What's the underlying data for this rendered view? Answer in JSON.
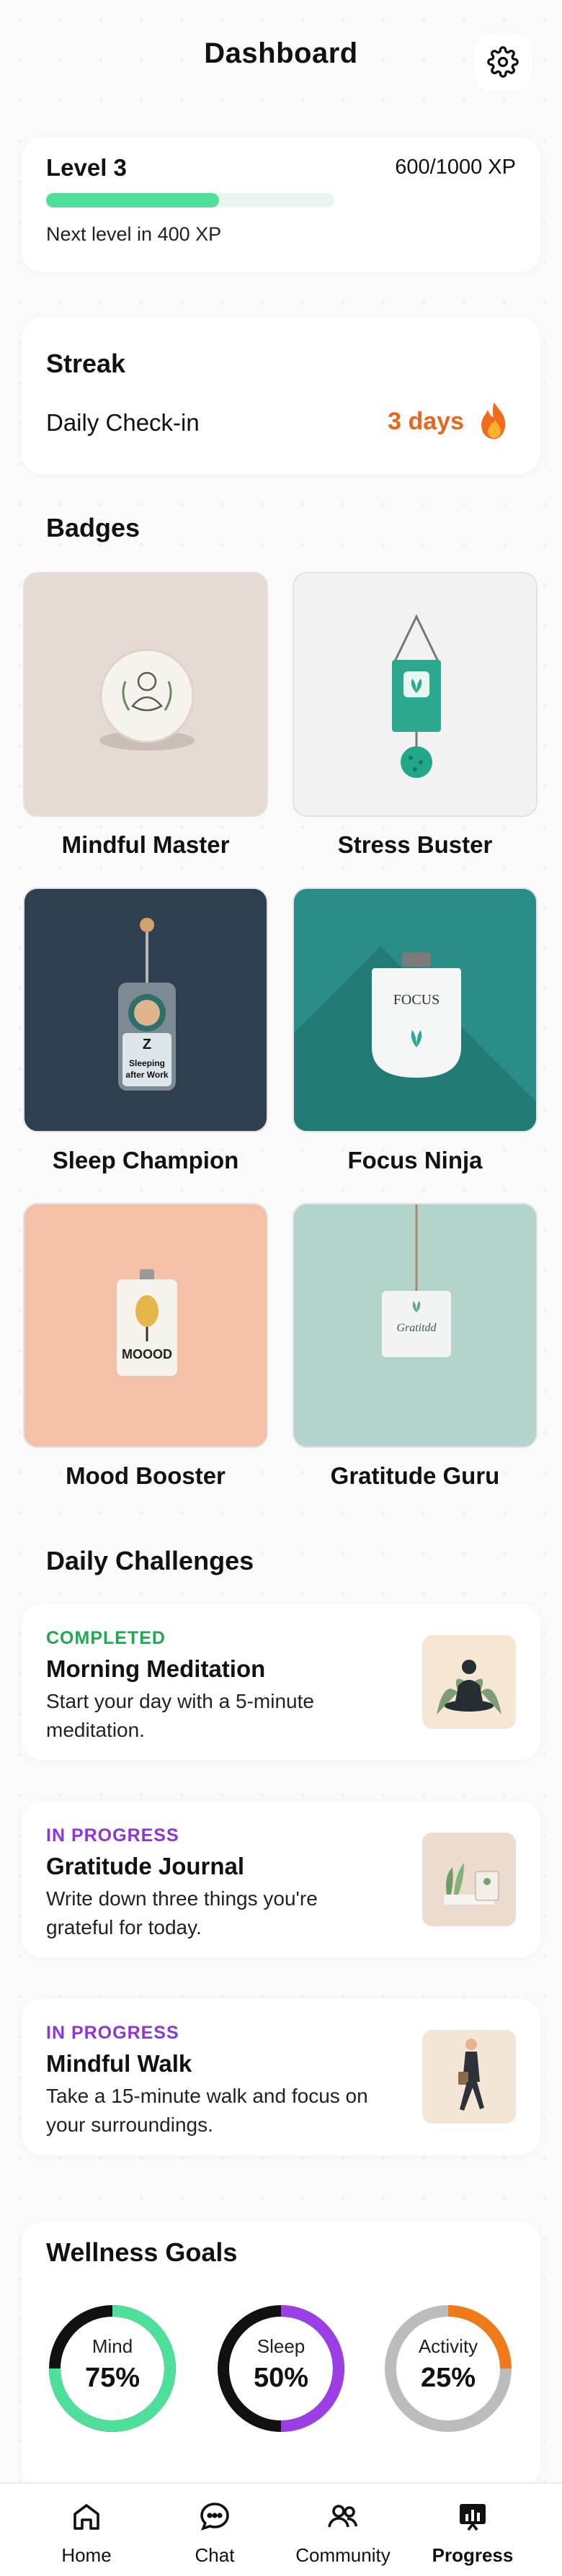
{
  "header": {
    "title": "Dashboard",
    "settings_icon": "gear-icon"
  },
  "level": {
    "title": "Level 3",
    "xp": "600/1000 XP",
    "progress": 0.6,
    "next": "Next level in 400 XP",
    "bar_color": "#4ee09a"
  },
  "streak": {
    "title": "Streak",
    "label": "Daily Check-in",
    "value": "3 days",
    "icon": "fire-icon",
    "value_color": "#e8661c"
  },
  "badges": {
    "title": "Badges",
    "items": [
      {
        "name": "Mindful Master",
        "art_text": ""
      },
      {
        "name": "Stress Buster",
        "art_text": ""
      },
      {
        "name": "Sleep Champion",
        "art_text": "Z\nSleeping\nafter Work"
      },
      {
        "name": "Focus Ninja",
        "art_text": "FOCUS"
      },
      {
        "name": "Mood Booster",
        "art_text": "MOOOD"
      },
      {
        "name": "Gratitude Guru",
        "art_text": "Gratitdd"
      }
    ]
  },
  "challenges": {
    "title": "Daily Challenges",
    "items": [
      {
        "status": "COMPLETED",
        "status_color": "#1ea84f",
        "title": "Morning Meditation",
        "desc": "Start your day with a 5-minute meditation.",
        "thumb": "meditation-illustration"
      },
      {
        "status": "IN PROGRESS",
        "status_color": "#8e35d6",
        "title": "Gratitude Journal",
        "desc": "Write down three things you're grateful for today.",
        "thumb": "journal-illustration"
      },
      {
        "status": "IN PROGRESS",
        "status_color": "#8e35d6",
        "title": "Mindful Walk",
        "desc": "Take a 15-minute walk and focus on your surroundings.",
        "thumb": "walking-illustration"
      }
    ]
  },
  "goals": {
    "title": "Wellness Goals",
    "items": [
      {
        "label": "Mind",
        "value": "75%",
        "fraction": 0.75,
        "color": "#4ee09a"
      },
      {
        "label": "Sleep",
        "value": "50%",
        "fraction": 0.5,
        "color": "#9b3ee6"
      },
      {
        "label": "Activity",
        "value": "25%",
        "fraction": 0.25,
        "color": "#f07a1a"
      }
    ]
  },
  "nav": {
    "items": [
      {
        "label": "Home",
        "icon": "home-icon",
        "active": false
      },
      {
        "label": "Chat",
        "icon": "chat-icon",
        "active": false
      },
      {
        "label": "Community",
        "icon": "community-icon",
        "active": false
      },
      {
        "label": "Progress",
        "icon": "progress-icon",
        "active": true
      }
    ]
  }
}
